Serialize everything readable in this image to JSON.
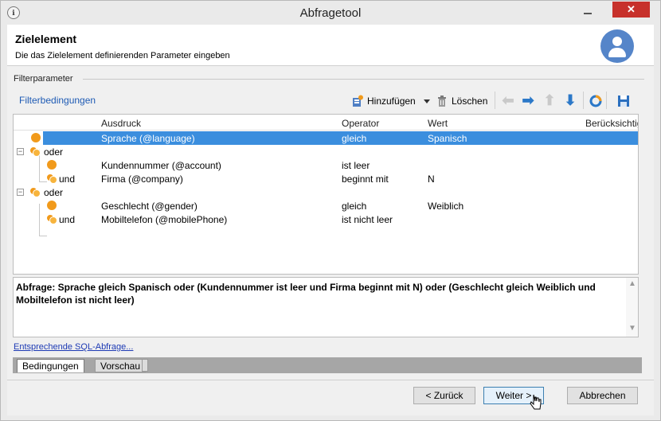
{
  "window": {
    "title": "Abfragetool",
    "close_label": "✕",
    "app_icon": "ℹ"
  },
  "header": {
    "title": "Zielelement",
    "subtitle": "Die das Zielelement definierenden Parameter eingeben",
    "avatar_icon": "user-avatar-icon"
  },
  "filter_group": {
    "label": "Filterparameter",
    "link": "Filterbedingungen"
  },
  "toolbar": {
    "add_label": "Hinzufügen",
    "delete_label": "Löschen",
    "icons": [
      "add-icon",
      "dropdown-arrow-icon",
      "trash-icon",
      "arrow-left-icon",
      "arrow-right-icon",
      "arrow-up-icon",
      "arrow-down-icon",
      "distribution-icon",
      "save-icon"
    ]
  },
  "grid": {
    "columns": [
      "Ausdruck",
      "Operator",
      "Wert",
      "Berücksichtig"
    ],
    "rows": [
      {
        "prefix": "",
        "expression": "Sprache (@language)",
        "operator": "gleich",
        "value": "Spanisch",
        "selected": true
      },
      {
        "prefix": "oder",
        "expression": "",
        "operator": "",
        "value": ""
      },
      {
        "prefix": "",
        "expression": "Kundennummer (@account)",
        "operator": "ist leer",
        "value": ""
      },
      {
        "prefix": "und",
        "expression": "Firma (@company)",
        "operator": "beginnt mit",
        "value": "N"
      },
      {
        "prefix": "oder",
        "expression": "",
        "operator": "",
        "value": ""
      },
      {
        "prefix": "",
        "expression": "Geschlecht (@gender)",
        "operator": "gleich",
        "value": "Weiblich"
      },
      {
        "prefix": "und",
        "expression": "Mobiltelefon (@mobilePhone)",
        "operator": "ist nicht leer",
        "value": ""
      }
    ],
    "scroll_left": "<",
    "scroll_right": ">"
  },
  "query": {
    "text": "Abfrage: Sprache gleich Spanisch oder (Kundennummer ist leer und Firma beginnt mit N) oder (Geschlecht gleich Weiblich und Mobiltelefon ist nicht leer)"
  },
  "sql_link": "Entsprechende SQL-Abfrage...",
  "tabs": [
    {
      "label": "Bedingungen",
      "active": true
    },
    {
      "label": "Vorschau",
      "active": false
    }
  ],
  "buttons": {
    "back": "< Zurück",
    "next": "Weiter >",
    "cancel": "Abbrechen"
  },
  "colors": {
    "selection": "#3b8ede",
    "accent_orange": "#f19a1b",
    "link": "#1d5ab4",
    "close_red": "#c7312b"
  }
}
